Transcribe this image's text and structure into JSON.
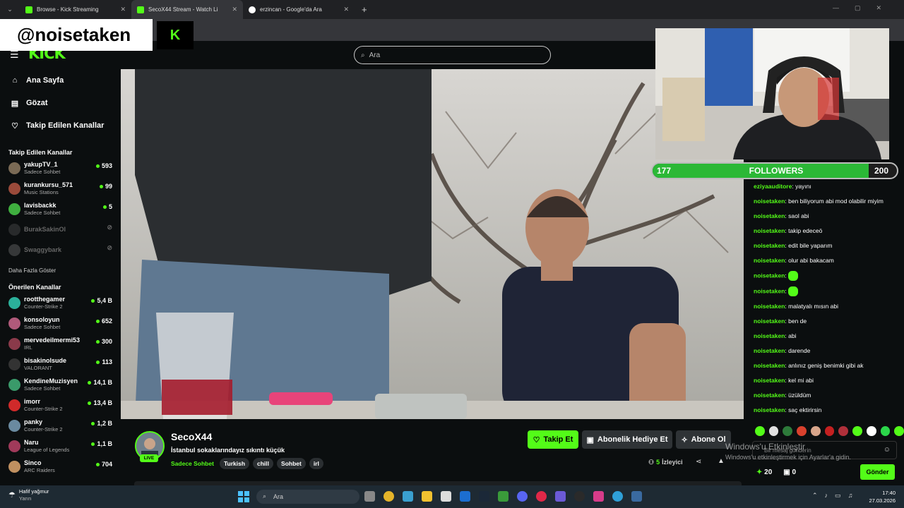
{
  "browser": {
    "tabs": [
      {
        "title": "Browse - Kick Streaming",
        "active": false
      },
      {
        "title": "SecoX44 Stream - Watch Li",
        "active": true
      },
      {
        "title": "erzincan - Google'da Ara",
        "active": false
      }
    ],
    "new_tab": "+"
  },
  "overlay": {
    "watermark": "@noisetaken",
    "followers": {
      "current": "177",
      "label": "FOLLOWERS",
      "goal": "200",
      "progress": 0.885
    }
  },
  "header": {
    "logo": "KICK",
    "search_placeholder": "Ara"
  },
  "sidebar": {
    "nav": [
      {
        "label": "Ana Sayfa",
        "icon": "home-icon"
      },
      {
        "label": "Gözat",
        "icon": "browse-icon"
      },
      {
        "label": "Takip Edilen Kanallar",
        "icon": "heart-icon"
      }
    ],
    "followed_title": "Takip Edilen Kanallar",
    "followed": [
      {
        "name": "yakupTV_1",
        "category": "Sadece Sohbet",
        "viewers": "593",
        "color": "#7a6a55"
      },
      {
        "name": "kurankursu_571",
        "category": "Music Stations",
        "viewers": "99",
        "color": "#9a4a3a"
      },
      {
        "name": "lavisbackk",
        "category": "Sadece Sohbet",
        "viewers": "5",
        "color": "#3fae3f"
      },
      {
        "name": "BurakSakinOl",
        "category": "",
        "viewers": "",
        "color": "#555"
      },
      {
        "name": "Swaggybark",
        "category": "",
        "viewers": "",
        "color": "#777"
      }
    ],
    "more": "Daha Fazla Göster",
    "recommended_title": "Önerilen Kanallar",
    "recommended": [
      {
        "name": "rootthegamer",
        "category": "Counter-Strike 2",
        "viewers": "5,4 B",
        "color": "#2bb09a"
      },
      {
        "name": "konsoloyun",
        "category": "Sadece Sohbet",
        "viewers": "652",
        "color": "#b05a7a"
      },
      {
        "name": "mervedeilmermi53",
        "category": "IRL",
        "viewers": "300",
        "color": "#8a3a4a"
      },
      {
        "name": "bisakinolsude",
        "category": "VALORANT",
        "viewers": "113",
        "color": "#333"
      },
      {
        "name": "KendineMuzisyen",
        "category": "Sadece Sohbet",
        "viewers": "14,1 B",
        "color": "#3a9a6a"
      },
      {
        "name": "imorr",
        "category": "Counter-Strike 2",
        "viewers": "13,4 B",
        "color": "#d02a2a"
      },
      {
        "name": "panky",
        "category": "Counter-Strike 2",
        "viewers": "1,2 B",
        "color": "#6a8aa0"
      },
      {
        "name": "Naru",
        "category": "League of Legends",
        "viewers": "1,1 B",
        "color": "#a03a5a"
      },
      {
        "name": "Sinco",
        "category": "ARC Raiders",
        "viewers": "704",
        "color": "#c09060"
      }
    ]
  },
  "stream": {
    "streamer": "SecoX44",
    "live_badge": "LIVE",
    "title": "İstanbul sokaklarındayız sıkıntı küçük",
    "category": "Sadece Sohbet",
    "tags": [
      "Turkish",
      "chill",
      "Sohbet",
      "irl"
    ],
    "buttons": {
      "follow": "Takip Et",
      "gift": "Abonelik Hediye Et",
      "subscribe": "Abone Ol"
    },
    "viewers_count": "5",
    "viewers_label": "İzleyici"
  },
  "chat": {
    "messages": [
      {
        "user": "eziyaauditore",
        "text": "yayını"
      },
      {
        "user": "noisetaken",
        "text": "ben biliyorum abi mod olabilir miyim"
      },
      {
        "user": "noisetaken",
        "text": "saol abi"
      },
      {
        "user": "noisetaken",
        "text": "takip edeceö"
      },
      {
        "user": "noisetaken",
        "text": "edit bile yaparım"
      },
      {
        "user": "noisetaken",
        "text": "olur abi bakacam"
      },
      {
        "user": "noisetaken",
        "text": "",
        "emote": true
      },
      {
        "user": "noisetaken",
        "text": "",
        "emote": true
      },
      {
        "user": "noisetaken",
        "text": "malatyalı mısın abi"
      },
      {
        "user": "noisetaken",
        "text": "ben de"
      },
      {
        "user": "noisetaken",
        "text": "abi"
      },
      {
        "user": "noisetaken",
        "text": "darende"
      },
      {
        "user": "noisetaken",
        "text": "anlınız geniş benimki gibi ak"
      },
      {
        "user": "noisetaken",
        "text": "kel mi abi"
      },
      {
        "user": "noisetaken",
        "text": "üzüldüm"
      },
      {
        "user": "noisetaken",
        "text": "saç ektirirsin"
      }
    ],
    "input_placeholder": "Bir mesaj gönderin",
    "points": "20",
    "other_count": "0",
    "send_label": "Gönder",
    "activation_title": "Windows'u Etkinleştir",
    "activation_sub": "Windows'u etkinleştirmek için Ayarlar'a gidin."
  },
  "taskbar": {
    "weather_title": "Hafif yağmur",
    "weather_sub": "Yarın",
    "search_placeholder": "Ara",
    "time": "17:40",
    "date": "27.03.2026"
  }
}
